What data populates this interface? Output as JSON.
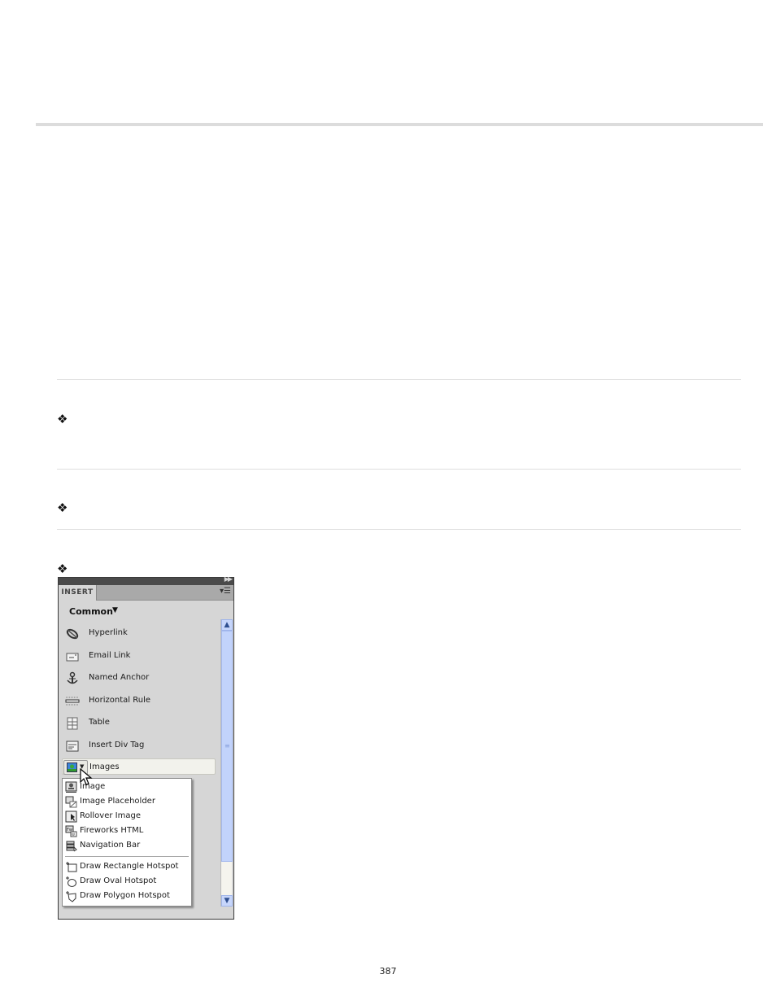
{
  "page": {
    "page_number": "387",
    "bullets": [
      "❖",
      "❖",
      "❖"
    ]
  },
  "insert_panel": {
    "tab_label": "INSERT",
    "category": "Common",
    "icons": {
      "collapse": "double-chevron-right-icon",
      "panel_menu": "panel-menu-icon",
      "category_dropdown": "triangle-down-icon",
      "scroll_up": "chevron-up-icon",
      "scroll_down": "chevron-down-icon"
    },
    "items": [
      {
        "label": "Hyperlink",
        "icon": "hyperlink-icon"
      },
      {
        "label": "Email Link",
        "icon": "email-link-icon"
      },
      {
        "label": "Named Anchor",
        "icon": "anchor-icon"
      },
      {
        "label": "Horizontal Rule",
        "icon": "horizontal-rule-icon"
      },
      {
        "label": "Table",
        "icon": "table-icon"
      },
      {
        "label": "Insert Div Tag",
        "icon": "div-tag-icon"
      }
    ],
    "images_button": {
      "label": "Images",
      "icon": "image-icon"
    },
    "images_menu": {
      "items": [
        {
          "label": "Image",
          "icon": "image-icon"
        },
        {
          "label": "Image Placeholder",
          "icon": "image-placeholder-icon"
        },
        {
          "label": "Rollover Image",
          "icon": "rollover-image-icon"
        },
        {
          "label": "Fireworks HTML",
          "icon": "fireworks-html-icon"
        },
        {
          "label": "Navigation Bar",
          "icon": "navigation-bar-icon"
        }
      ],
      "hotspot_items": [
        {
          "label": "Draw Rectangle Hotspot",
          "icon": "rectangle-hotspot-icon"
        },
        {
          "label": "Draw Oval Hotspot",
          "icon": "oval-hotspot-icon"
        },
        {
          "label": "Draw Polygon Hotspot",
          "icon": "polygon-hotspot-icon"
        }
      ]
    }
  }
}
